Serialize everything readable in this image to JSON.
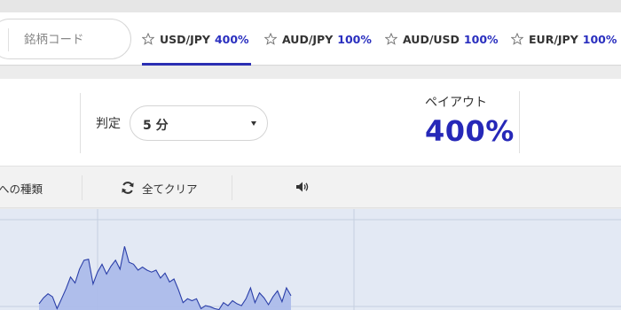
{
  "search": {
    "placeholder": "銘柄コード"
  },
  "tabs": [
    {
      "symbol": "USD/JPY",
      "payout": "400%",
      "active": true
    },
    {
      "symbol": "AUD/JPY",
      "payout": "100%",
      "active": false
    },
    {
      "symbol": "AUD/USD",
      "payout": "100%",
      "active": false
    },
    {
      "symbol": "EUR/JPY",
      "payout": "100%",
      "active": false
    }
  ],
  "trade": {
    "judge_label": "判定",
    "judge_value": "5 分",
    "payout_label": "ペイアウト",
    "payout_value": "400%"
  },
  "toolbar": {
    "order_type_partial": "への種類",
    "clear_all": "全てクリア",
    "speaker_icon": "speaker-icon",
    "refresh_icon": "refresh-icon"
  },
  "colors": {
    "accent": "#2628b8",
    "tab_underline": "#2b2fb3",
    "chart_line": "#2a3ea8",
    "chart_fill": "#a9b9ea",
    "chart_bg": "#e3e9f4"
  },
  "chart_data": {
    "type": "area",
    "series": [
      {
        "values": [
          1.0,
          1.6,
          2.0,
          1.7,
          0.5,
          1.5,
          2.5,
          3.7,
          3.1,
          4.5,
          5.4,
          5.5,
          3.0,
          4.2,
          5.0,
          4.0,
          4.8,
          5.4,
          4.5,
          6.8,
          5.2,
          5.0,
          4.4,
          4.7,
          4.4,
          4.2,
          4.4,
          3.6,
          4.1,
          3.2,
          3.5,
          2.4,
          1.1,
          1.5,
          1.3,
          1.5,
          0.5,
          0.8,
          0.7,
          0.5,
          0.4,
          1.1,
          0.8,
          1.3,
          1.0,
          0.8,
          1.5,
          2.6,
          1.1,
          2.1,
          1.6,
          0.9,
          1.7,
          2.3,
          1.2,
          2.6,
          1.8
        ]
      }
    ]
  }
}
